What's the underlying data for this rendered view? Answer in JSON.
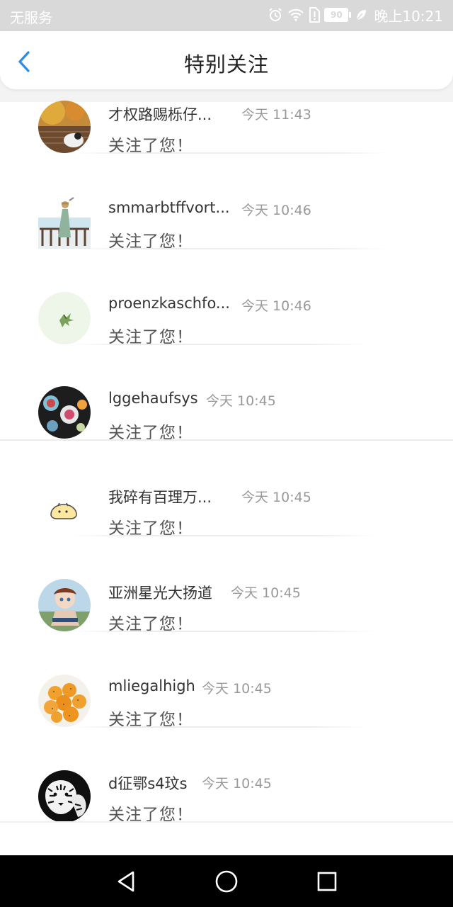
{
  "status_bar": {
    "carrier": "无服务",
    "battery": "90",
    "time": "晚上10:21"
  },
  "header": {
    "title": "特别关注"
  },
  "items": [
    {
      "name": "才权路赐栎仔...",
      "time": "今天 11:43",
      "message": "关注了您！"
    },
    {
      "name": "smmarbtffvort...",
      "time": "今天 10:46",
      "message": "关注了您！"
    },
    {
      "name": "proenzkaschfo...",
      "time": "今天 10:46",
      "message": "关注了您！"
    },
    {
      "name": "lggehaufsys",
      "time": "今天 10:45",
      "message": "关注了您！"
    },
    {
      "name": "我碎有百理万...",
      "time": "今天 10:45",
      "message": "关注了您！"
    },
    {
      "name": "亚洲星光大扬道",
      "time": "今天 10:45",
      "message": "关注了您！"
    },
    {
      "name": "mliegalhigh",
      "time": "今天 10:45",
      "message": "关注了您！"
    },
    {
      "name": "d征鄂s4玟s",
      "time": "今天 10:45",
      "message": "关注了您！"
    }
  ],
  "colors": {
    "accent": "#2b8ce8",
    "status_bar_bg": "#d9d9d9",
    "nav_bar_bg": "#000000"
  },
  "icons": {
    "back": "chevron-left-icon",
    "alarm": "alarm-icon",
    "wifi": "wifi-icon",
    "sim": "sim-alert-icon",
    "battery": "battery-icon",
    "leaf": "leaf-icon",
    "nav_back": "triangle-back-icon",
    "nav_home": "circle-home-icon",
    "nav_recent": "square-recent-icon"
  }
}
